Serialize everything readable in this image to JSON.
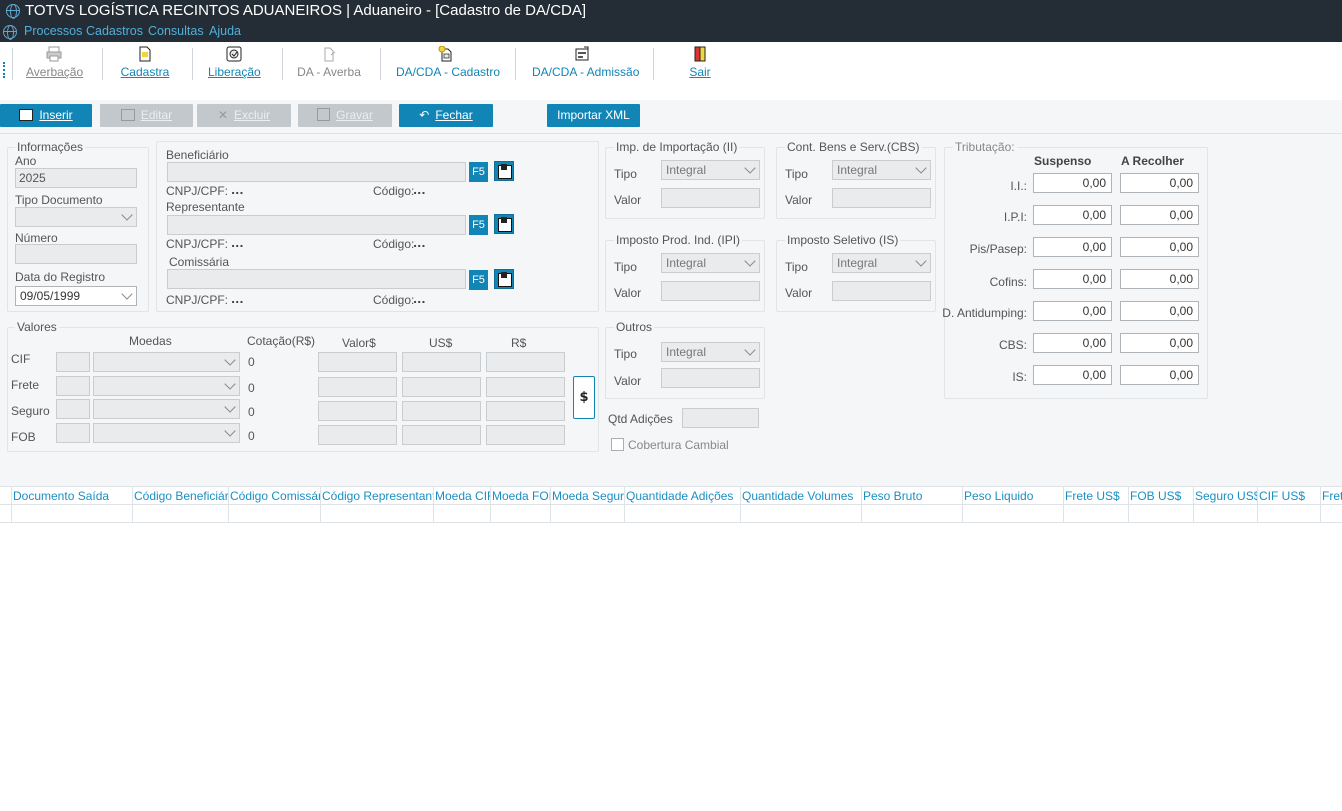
{
  "window": {
    "title": "TOTVS LOGÍSTICA RECINTOS ADUANEIROS | Aduaneiro - [Cadastro de DA/CDA]",
    "menu": [
      "Processos",
      "Cadastros",
      "Consultas",
      "Ajuda"
    ]
  },
  "toolbar": {
    "items": [
      {
        "label": "Averbação",
        "icon": "printer-icon",
        "enabled": false
      },
      {
        "label": "Cadastra",
        "icon": "document-icon",
        "enabled": true
      },
      {
        "label": "Liberação",
        "icon": "seal-icon",
        "enabled": true
      },
      {
        "label": "DA - Averba",
        "icon": "stamp-icon",
        "enabled": false
      },
      {
        "label": "DA/CDA - Cadastro",
        "icon": "new-document-icon",
        "enabled": true
      },
      {
        "label": "DA/CDA - Admissão",
        "icon": "register-icon",
        "enabled": true
      },
      {
        "label": "Sair",
        "icon": "exit-door-icon",
        "enabled": true
      }
    ]
  },
  "actions": {
    "inserir": "Inserir",
    "editar": "Editar",
    "excluir": "Excluir",
    "gravar": "Gravar",
    "fechar": "Fechar",
    "importar_xml": "Importar XML"
  },
  "informacoes": {
    "legend": "Informações",
    "ano_label": "Ano",
    "ano_value": "2025",
    "tipo_documento_label": "Tipo Documento",
    "numero_label": "Número",
    "data_registro_label": "Data do Registro",
    "data_registro_value": "09/05/1999"
  },
  "partes": {
    "beneficiario_label": "Beneficiário",
    "representante_label": "Representante",
    "comissaria_label": "Comissária",
    "f5": "F5",
    "cnpj_label": "CNPJ/CPF:",
    "codigo_label": "Código:",
    "placeholder_dots": "..."
  },
  "valores": {
    "legend": "Valores",
    "moedas_header": "Moedas",
    "cotacao_header": "Cotação(R$)",
    "valor_header": "Valor$",
    "us_header": "US$",
    "rs_header": "R$",
    "rows": [
      {
        "label": "CIF",
        "cotacao": "0"
      },
      {
        "label": "Frete",
        "cotacao": "0"
      },
      {
        "label": "Seguro",
        "cotacao": "0"
      },
      {
        "label": "FOB",
        "cotacao": "0"
      }
    ],
    "calc_button": "$"
  },
  "impostos": {
    "tipo_label": "Tipo",
    "valor_label": "Valor",
    "integral": "Integral",
    "ii_legend": "Imp. de Importação (II)",
    "cbs_legend": "Cont. Bens e Serv.(CBS)",
    "ipi_legend": "Imposto Prod. Ind. (IPI)",
    "is_legend": "Imposto Seletivo (IS)",
    "outros_legend": "Outros",
    "qtd_adicoes_label": "Qtd Adições",
    "cobertura_cambial_label": "Cobertura Cambial"
  },
  "tributacao": {
    "legend": "Tributação:",
    "suspenso_header": "Suspenso",
    "recolher_header": "A Recolher",
    "rows": [
      {
        "label": "I.I.:",
        "suspenso": "0,00",
        "recolher": "0,00"
      },
      {
        "label": "I.P.I:",
        "suspenso": "0,00",
        "recolher": "0,00"
      },
      {
        "label": "Pis/Pasep:",
        "suspenso": "0,00",
        "recolher": "0,00"
      },
      {
        "label": "Cofins:",
        "suspenso": "0,00",
        "recolher": "0,00"
      },
      {
        "label": "D. Antidumping:",
        "suspenso": "0,00",
        "recolher": "0,00"
      },
      {
        "label": "CBS:",
        "suspenso": "0,00",
        "recolher": "0,00"
      },
      {
        "label": "IS:",
        "suspenso": "0,00",
        "recolher": "0,00"
      }
    ]
  },
  "grid": {
    "columns": [
      "Documento Saída",
      "Código Beneficiário",
      "Código Comissária",
      "Código Representante",
      "Moeda CIF",
      "Moeda FOB",
      "Moeda Seguro",
      "Quantidade Adições",
      "Quantidade Volumes",
      "Peso Bruto",
      "Peso Liquido",
      "Frete US$",
      "FOB US$",
      "Seguro US$",
      "CIF US$",
      "Fret"
    ]
  }
}
